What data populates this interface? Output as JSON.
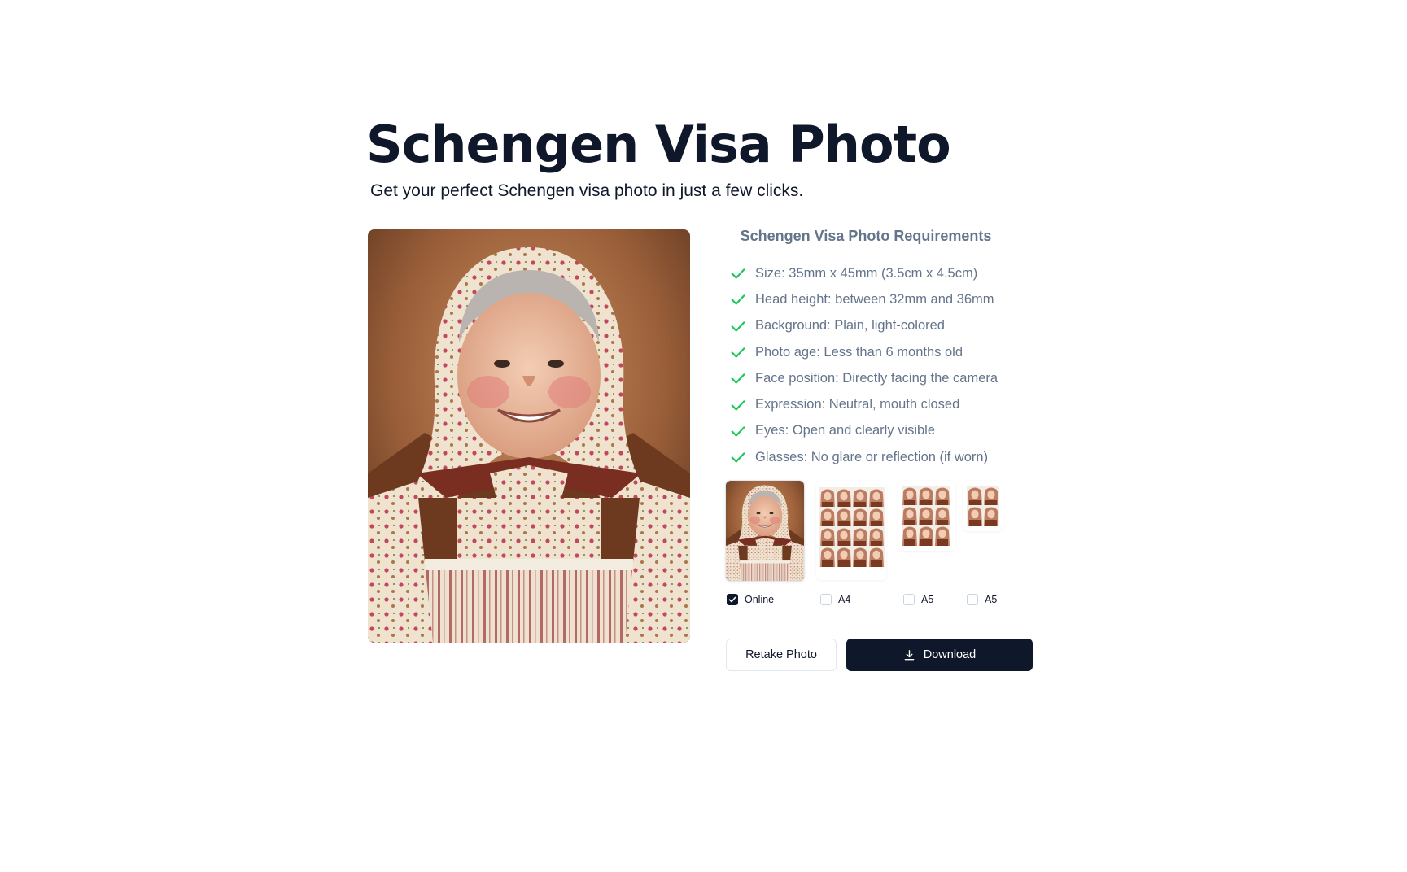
{
  "page": {
    "title": "Schengen Visa Photo",
    "subtitle": "Get your perfect Schengen visa photo in just a few clicks."
  },
  "requirements": {
    "heading": "Schengen Visa Photo Requirements",
    "items": [
      {
        "label": "Size: 35mm x 45mm (3.5cm x 4.5cm)"
      },
      {
        "label": "Head height: between 32mm and 36mm"
      },
      {
        "label": "Background: Plain, light-colored"
      },
      {
        "label": "Photo age: Less than 6 months old"
      },
      {
        "label": "Face position: Directly facing the camera"
      },
      {
        "label": "Expression: Neutral, mouth closed"
      },
      {
        "label": "Eyes: Open and clearly visible"
      },
      {
        "label": "Glasses: No glare or reflection (if worn)"
      }
    ],
    "check_icon": "check-icon",
    "check_color": "#22c55e"
  },
  "options": [
    {
      "label": "Online",
      "checked": true
    },
    {
      "label": "A4",
      "checked": false
    },
    {
      "label": "A5",
      "checked": false
    },
    {
      "label": "A5",
      "checked": false
    }
  ],
  "buttons": {
    "retake": "Retake Photo",
    "download": "Download",
    "download_icon": "download-icon"
  },
  "colors": {
    "primary": "#0f172a",
    "muted_text": "#64748b",
    "border": "#e2e8f0"
  }
}
